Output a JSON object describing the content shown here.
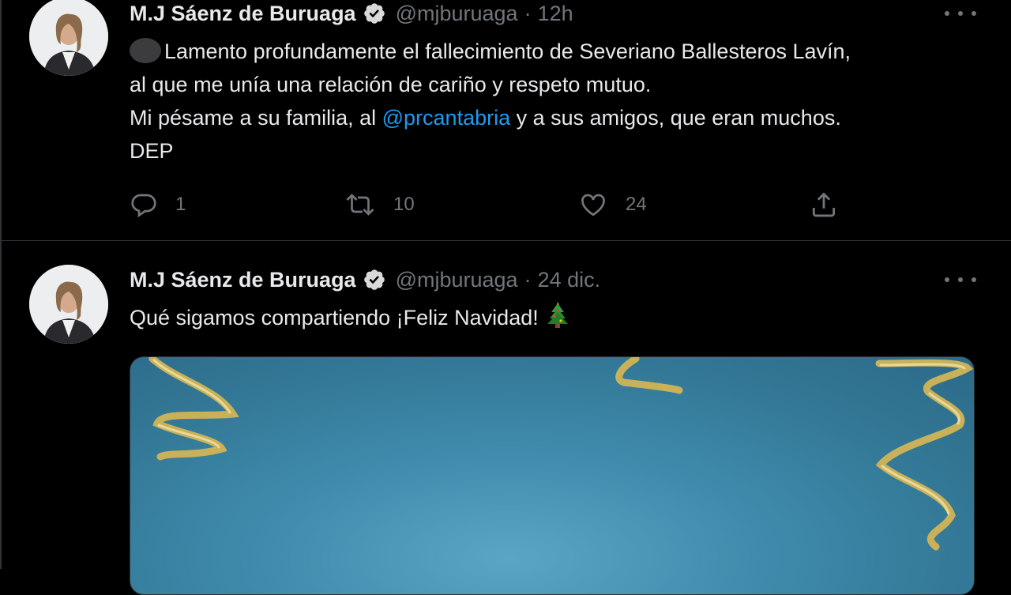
{
  "colors": {
    "background": "#000000",
    "text": "#e7e9ea",
    "secondary": "#71767b",
    "link": "#1d9bf0",
    "divider": "#2f3336"
  },
  "tweets": [
    {
      "author_name": "M.J Sáenz de Buruaga",
      "handle": "@mjburuaga",
      "separator": "·",
      "time": "12h",
      "text_lines": [
        "Lamento profundamente el fallecimiento de Severiano Ballesteros Lavín,",
        "al que me unía una relación de cariño y respeto mutuo."
      ],
      "line3_before": "Mi pésame a su familia, al ",
      "mention": "@prcantabria",
      "line3_after": " y a sus amigos, que eran muchos.",
      "line4": "DEP",
      "replies": "1",
      "retweets": "10",
      "likes": "24",
      "icons": [
        "verified-badge-icon",
        "more-options-icon",
        "reply-icon",
        "retweet-icon",
        "like-icon",
        "share-icon"
      ]
    },
    {
      "author_name": "M.J Sáenz de Buruaga",
      "handle": "@mjburuaga",
      "separator": "·",
      "time": "24 dic.",
      "text": "Qué sigamos compartiendo ¡Feliz Navidad!",
      "emoji": "christmas-tree-icon",
      "media": "christmas-streamers-image"
    }
  ]
}
